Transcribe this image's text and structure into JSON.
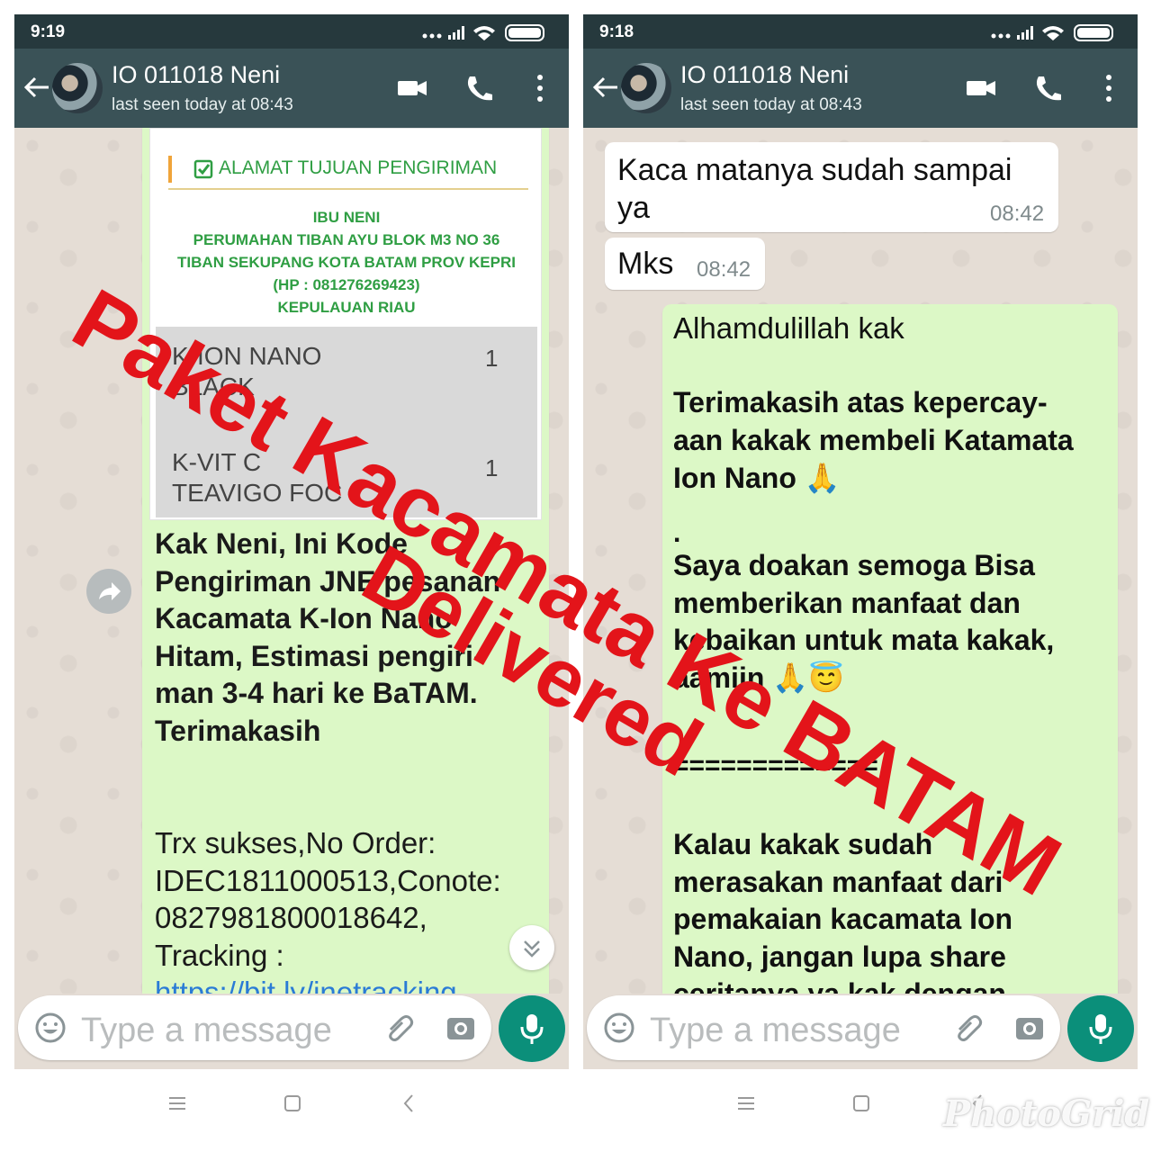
{
  "left_phone": {
    "status_time": "9:19",
    "contact_name": "IO 011018 Neni",
    "last_seen": "last seen today at 08:43",
    "order_card": {
      "heading": "ALAMAT TUJUAN PENGIRIMAN",
      "address_lines": [
        "IBU NENI",
        "PERUMAHAN TIBAN AYU BLOK M3 NO 36",
        "TIBAN SEKUPANG KOTA BATAM PROV KEPRI",
        "(HP : 081276269423)",
        "KEPULAUAN RIAU"
      ],
      "items": [
        {
          "name_line1": "K-ION NANO",
          "name_line2": "BLACK",
          "qty": "1"
        },
        {
          "name_line1": "K-VIT C",
          "name_line2": "TEAVIGO FOC",
          "qty": "1"
        }
      ]
    },
    "message_bold": [
      "Kak Neni, Ini Kode",
      "Pengiriman JNE pesanan",
      "Kacamata K-Ion Nano",
      "Hitam, Estimasi pengiri-",
      "man 3-4 hari ke BaTAM.",
      "Terimakasih"
    ],
    "message_regular": [
      "Trx sukses,No Order:",
      "IDEC1811000513,Conote:",
      "0827981800018642,",
      "Tracking :",
      "https://bit.ly/jnetracking"
    ],
    "input_placeholder": "Type a message"
  },
  "right_phone": {
    "status_time": "9:18",
    "contact_name": "IO 011018 Neni",
    "last_seen": "last seen today at 08:43",
    "incoming": [
      {
        "lines": [
          "Kaca matanya sudah sampai",
          "ya"
        ],
        "time": "08:42"
      },
      {
        "lines": [
          "Mks"
        ],
        "time": "08:42"
      }
    ],
    "outgoing_first": "Alhamdulillah kak",
    "outgoing_bold_1": [
      "Terimakasih atas kepercay-",
      "aan kakak membeli Katamata",
      "Ion Nano 🙏"
    ],
    "outgoing_dot": ".",
    "outgoing_bold_2": [
      "Saya doakan semoga Bisa",
      "memberikan manfaat dan",
      "kebaikan untuk mata kakak,",
      "aamiin 🙏😇"
    ],
    "separator": "=============",
    "outgoing_bold_3": [
      "Kalau kakak sudah",
      "merasakan manfaat dari",
      "pemakaian kacamata Ion",
      "Nano, jangan lupa share",
      "ceritanya ya kak dengan keluarga"
    ],
    "input_placeholder": "Type a message"
  },
  "overlay": {
    "line1": "Paket Kacamata Ke BATAM",
    "line2": "Delivered",
    "color": "#e3141a"
  },
  "watermark": "PhotoGrid",
  "colors": {
    "header": "#3a5257",
    "statusbar": "#26393d",
    "outgoing_bubble": "#dcf8c6",
    "incoming_bubble": "#ffffff",
    "mic_button": "#0b8f7a",
    "address_green": "#2f9e43"
  }
}
